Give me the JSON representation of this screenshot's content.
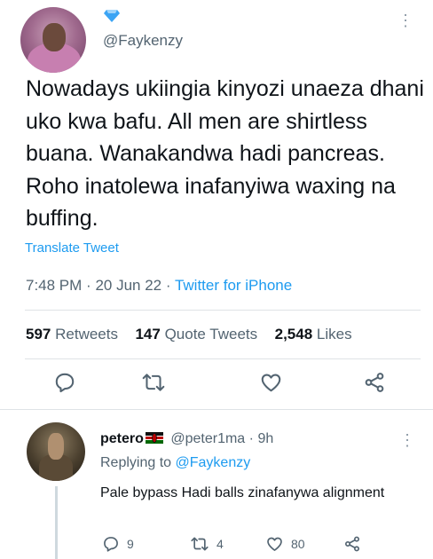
{
  "tweet": {
    "handle": "@Faykenzy",
    "text": "Nowadays ukiingia kinyozi unaeza dhani uko kwa bafu. All men are shirtless buana. Wanakandwa hadi pancreas. Roho inatolewa inafanyiwa waxing na buffing.",
    "translate_label": "Translate Tweet",
    "time": "7:48 PM",
    "date": "20 Jun 22",
    "source": "Twitter for iPhone",
    "stats": {
      "retweets_count": "597",
      "retweets_label": "Retweets",
      "quotes_count": "147",
      "quotes_label": "Quote Tweets",
      "likes_count": "2,548",
      "likes_label": "Likes"
    }
  },
  "reply": {
    "name": "petero",
    "handle": "@peter1ma",
    "age": "9h",
    "replying_prefix": "Replying to",
    "replying_to": "@Faykenzy",
    "text": "Pale bypass Hadi balls zinafanywa alignment",
    "replies": "9",
    "retweets": "4",
    "likes": "80"
  },
  "icons": [
    "diamond-icon",
    "more-icon",
    "reply-icon",
    "retweet-icon",
    "like-icon",
    "share-icon",
    "kenya-flag-icon"
  ],
  "colors": {
    "accent": "#1d9bf0",
    "text": "#0f1419",
    "muted": "#536471",
    "divider": "#dfe3e6"
  }
}
